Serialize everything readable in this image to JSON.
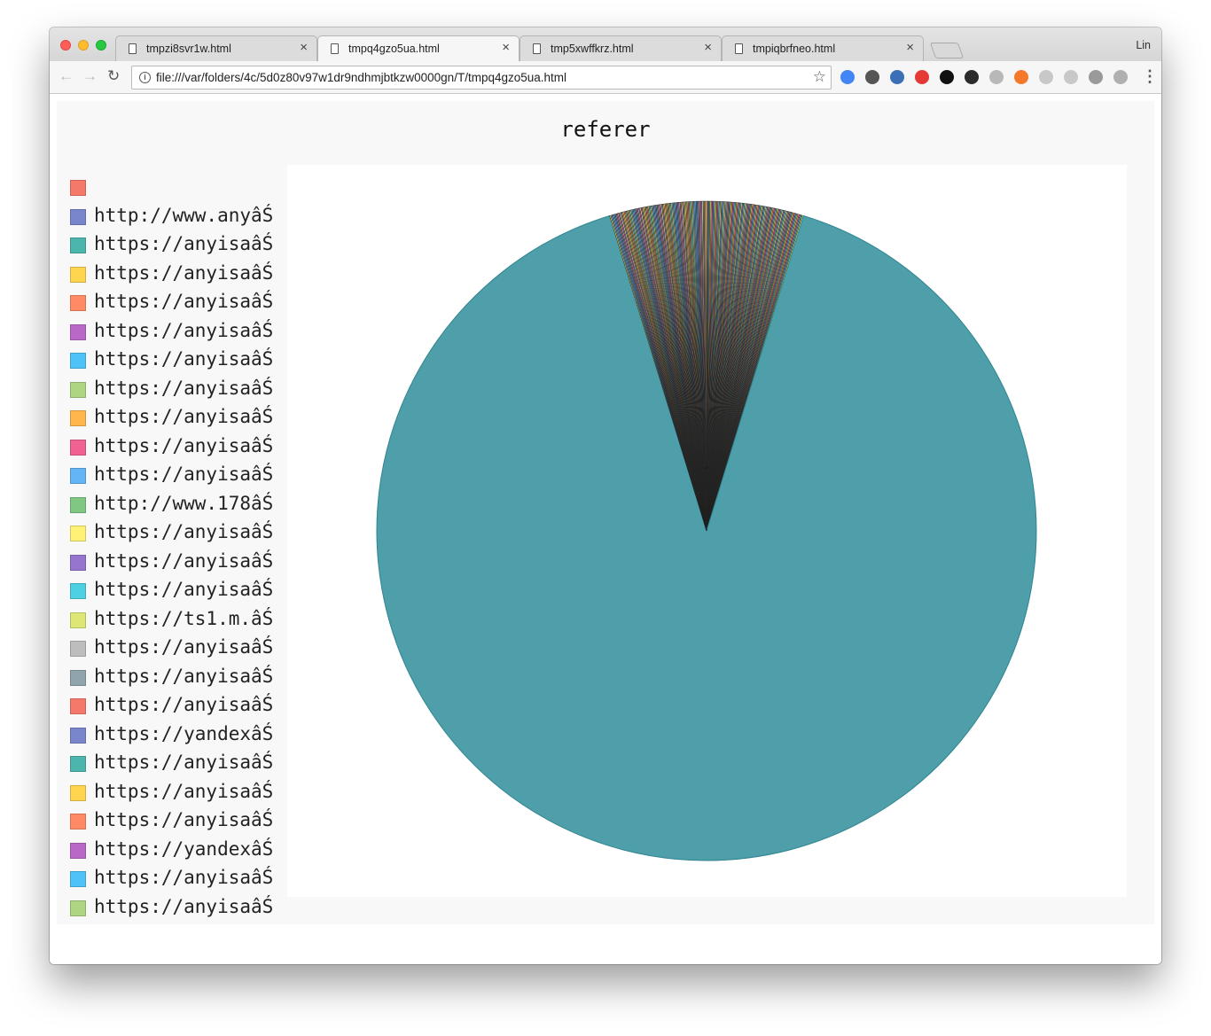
{
  "browser": {
    "tabs": [
      {
        "title": "tmpzi8svr1w.html",
        "active": false
      },
      {
        "title": "tmpq4gzo5ua.html",
        "active": true
      },
      {
        "title": "tmp5xwffkrz.html",
        "active": false
      },
      {
        "title": "tmpiqbrfneo.html",
        "active": false
      }
    ],
    "user_label": "Lin",
    "address_bar_url": "file:///var/folders/4c/5d0z80v97w1dr9ndhmjbtkzw0000gn/T/tmpq4gzo5ua.html",
    "toolbar_icons": [
      "back-icon",
      "forward-icon",
      "reload-icon",
      "info-icon",
      "bookmark-star-icon",
      "menu-kebab-icon"
    ],
    "extension_icon_colors": [
      "#4285f4",
      "#555555",
      "#3b6fb6",
      "#e53935",
      "#111111",
      "#2b2b2b",
      "#b8b8b8",
      "#f4792b",
      "#c8c8c8",
      "#c8c8c8",
      "#9a9a9a",
      "#b0b0b0"
    ]
  },
  "chart_data": {
    "type": "pie",
    "title": "referer",
    "legend_position": "left",
    "legend_entries": [
      {
        "label": "",
        "color": "#f4796b"
      },
      {
        "label": "http://www.anyâŚ",
        "color": "#7986cb"
      },
      {
        "label": "https://anyisaâŚ",
        "color": "#4db6ac"
      },
      {
        "label": "https://anyisaâŚ",
        "color": "#ffd54f"
      },
      {
        "label": "https://anyisaâŚ",
        "color": "#ff8a65"
      },
      {
        "label": "https://anyisaâŚ",
        "color": "#ba68c8"
      },
      {
        "label": "https://anyisaâŚ",
        "color": "#4fc3f7"
      },
      {
        "label": "https://anyisaâŚ",
        "color": "#aed581"
      },
      {
        "label": "https://anyisaâŚ",
        "color": "#ffb74d"
      },
      {
        "label": "https://anyisaâŚ",
        "color": "#f06292"
      },
      {
        "label": "https://anyisaâŚ",
        "color": "#64b5f6"
      },
      {
        "label": "http://www.178âŚ",
        "color": "#81c784"
      },
      {
        "label": "https://anyisaâŚ",
        "color": "#fff176"
      },
      {
        "label": "https://anyisaâŚ",
        "color": "#9575cd"
      },
      {
        "label": "https://anyisaâŚ",
        "color": "#4dd0e1"
      },
      {
        "label": "https://ts1.m.âŚ",
        "color": "#dce775"
      },
      {
        "label": "https://anyisaâŚ",
        "color": "#bdbdbd"
      },
      {
        "label": "https://anyisaâŚ",
        "color": "#90a4ae"
      },
      {
        "label": "https://anyisaâŚ",
        "color": "#f4796b"
      },
      {
        "label": "https://yandexâŚ",
        "color": "#7986cb"
      },
      {
        "label": "https://anyisaâŚ",
        "color": "#4db6ac"
      },
      {
        "label": "https://anyisaâŚ",
        "color": "#ffd54f"
      },
      {
        "label": "https://anyisaâŚ",
        "color": "#ff8a65"
      },
      {
        "label": "https://yandexâŚ",
        "color": "#ba68c8"
      },
      {
        "label": "https://anyisaâŚ",
        "color": "#4fc3f7"
      },
      {
        "label": "https://anyisaâŚ",
        "color": "#aed581"
      }
    ],
    "dominant_slice": {
      "share_percent": 90.5,
      "color": "#4e9faa"
    },
    "minor_slices": {
      "count": 170,
      "total_share_percent": 9.5,
      "colors": [
        "#f4796b",
        "#7986cb",
        "#4db6ac",
        "#ffd54f",
        "#ff8a65",
        "#ba68c8",
        "#4fc3f7",
        "#aed581",
        "#ffb74d",
        "#f06292",
        "#64b5f6",
        "#81c784",
        "#fff176",
        "#9575cd",
        "#4dd0e1",
        "#dce775",
        "#bdbdbd",
        "#90a4ae"
      ]
    },
    "slice_stroke_color": "#222222"
  }
}
